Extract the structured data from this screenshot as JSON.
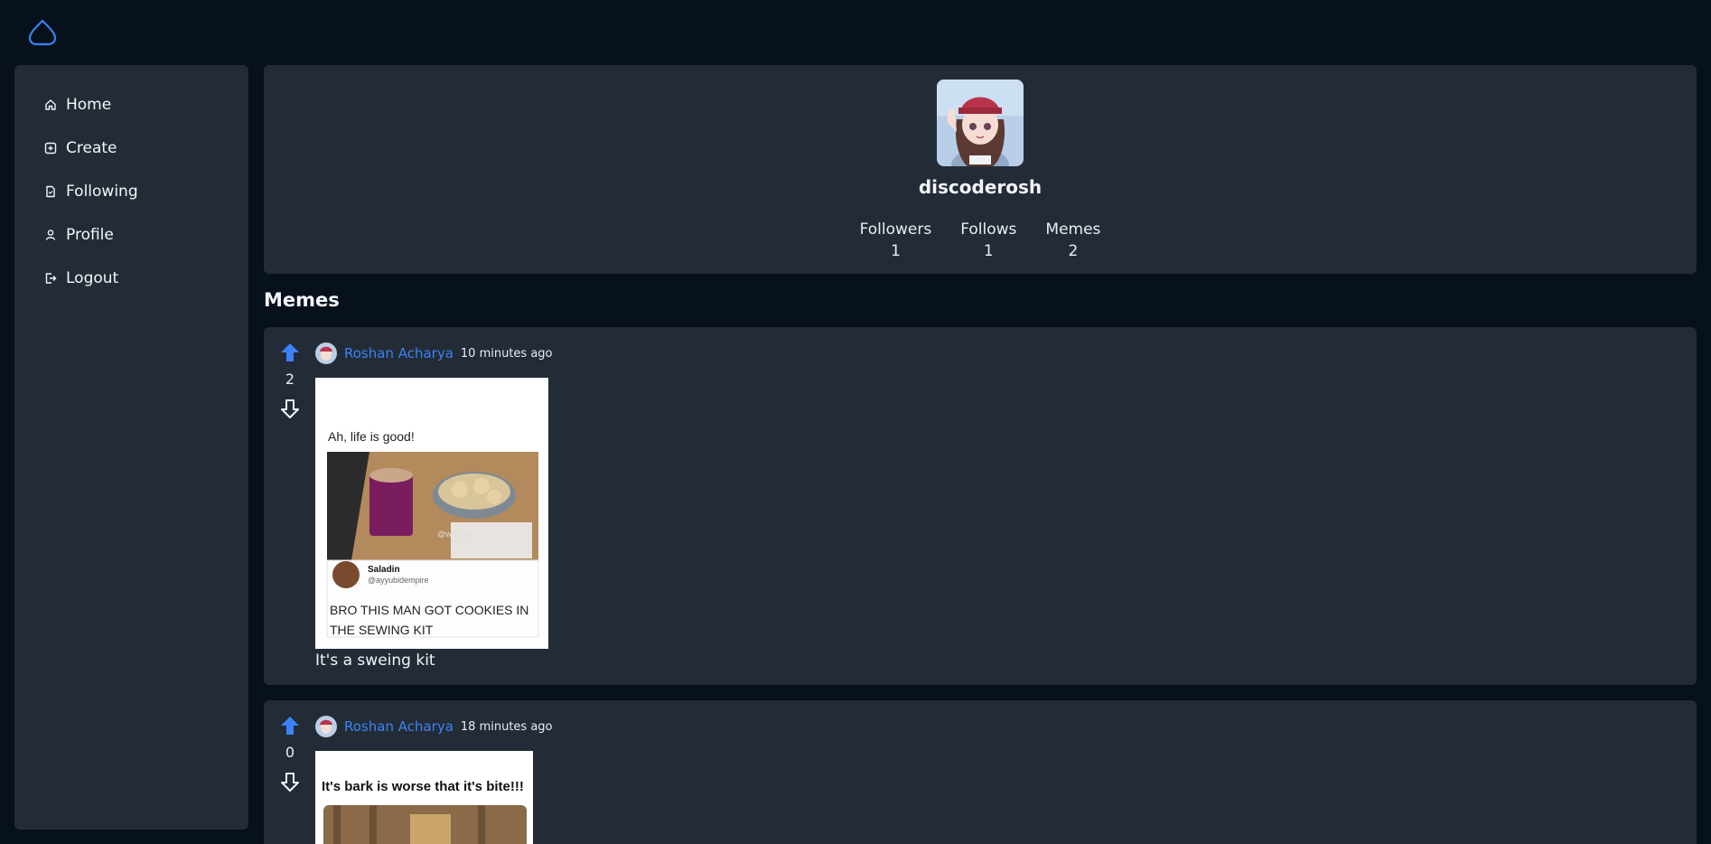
{
  "sidebar": {
    "items": [
      {
        "label": "Home",
        "icon": "home-icon"
      },
      {
        "label": "Create",
        "icon": "plus-square-icon"
      },
      {
        "label": "Following",
        "icon": "file-icon"
      },
      {
        "label": "Profile",
        "icon": "user-icon"
      },
      {
        "label": "Logout",
        "icon": "logout-icon"
      }
    ]
  },
  "profile": {
    "username": "discoderosh",
    "stats": [
      {
        "label": "Followers",
        "value": "1"
      },
      {
        "label": "Follows",
        "value": "1"
      },
      {
        "label": "Memes",
        "value": "2"
      }
    ]
  },
  "memes_section": {
    "title": "Memes"
  },
  "memes": [
    {
      "votes": "2",
      "author": "Roshan Acharya",
      "time": "10 minutes ago",
      "caption": "It's a sweing kit",
      "image": {
        "text_top": "Ah, life is good!",
        "tweet_name": "Saladin",
        "tweet_handle": "@ayyubidempire",
        "tweet_text_1": "BRO THIS MAN GOT COOKIES IN",
        "tweet_text_2": "THE SEWING KIT",
        "watermark": "@will_ent"
      }
    },
    {
      "votes": "0",
      "author": "Roshan Acharya",
      "time": "18 minutes ago",
      "caption": "",
      "image": {
        "text_top": "It's bark is worse that it's bite!!!"
      }
    }
  ],
  "colors": {
    "page_bg": "#06111b",
    "card_bg": "#232c36",
    "accent": "#3b82f6"
  }
}
